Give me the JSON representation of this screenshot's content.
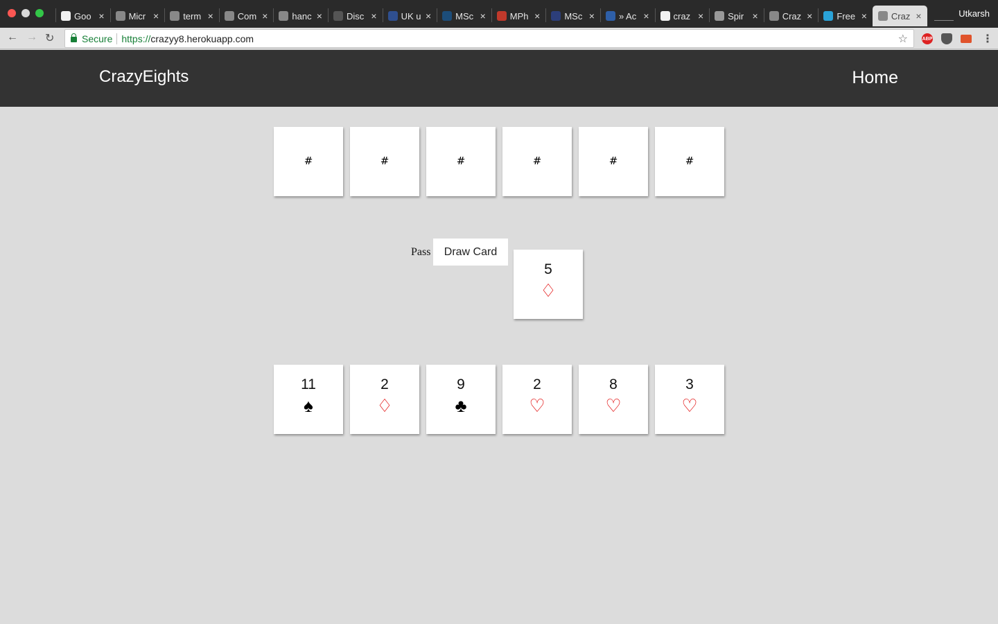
{
  "browser": {
    "tabs": [
      {
        "title": "Goo",
        "favicon": "google-drive-icon",
        "color": "#f1f1f1"
      },
      {
        "title": "Micr",
        "favicon": "page-icon",
        "color": "#888888"
      },
      {
        "title": "term",
        "favicon": "page-icon",
        "color": "#888888"
      },
      {
        "title": "Com",
        "favicon": "page-icon",
        "color": "#888888"
      },
      {
        "title": "hanc",
        "favicon": "page-icon",
        "color": "#888888"
      },
      {
        "title": "Disc",
        "favicon": "discord-icon",
        "color": "#555555"
      },
      {
        "title": "UK u",
        "favicon": "globe-icon",
        "color": "#2f4f8f"
      },
      {
        "title": "MSc",
        "favicon": "s-logo-icon",
        "color": "#1c4d7a"
      },
      {
        "title": "MPh",
        "favicon": "crest-icon",
        "color": "#c0392b"
      },
      {
        "title": "MSc",
        "favicon": "shield-icon",
        "color": "#2c3e7a"
      },
      {
        "title": "» Ac",
        "favicon": "bank-icon",
        "color": "#2e5fa8"
      },
      {
        "title": "craz",
        "favicon": "google-g-icon",
        "color": "#f1f1f1"
      },
      {
        "title": "Spir",
        "favicon": "image-icon",
        "color": "#999999"
      },
      {
        "title": "Craz",
        "favicon": "page-icon",
        "color": "#888888"
      },
      {
        "title": "Free",
        "favicon": "code-icon",
        "color": "#2aa3d8"
      },
      {
        "title": "Craz",
        "favicon": "page-icon",
        "color": "#888888",
        "active": true
      }
    ],
    "profile_name": "Utkarsh",
    "secure_label": "Secure",
    "url_scheme": "https://",
    "url_host": "crazyy8.herokuapp.com"
  },
  "navbar": {
    "brand": "CrazyEights",
    "home_label": "Home"
  },
  "opponent_hand": {
    "cards": [
      "#",
      "#",
      "#",
      "#",
      "#",
      "#"
    ]
  },
  "controls": {
    "pass_label": "Pass",
    "draw_label": "Draw Card"
  },
  "discard_pile": {
    "rank": "5",
    "suit": "♢",
    "suit_name": "diamonds",
    "suit_color": "#e00000"
  },
  "player_hand": {
    "cards": [
      {
        "rank": "11",
        "suit": "♠",
        "suit_name": "spades",
        "suit_color": "#000000"
      },
      {
        "rank": "2",
        "suit": "♢",
        "suit_name": "diamonds",
        "suit_color": "#e00000"
      },
      {
        "rank": "9",
        "suit": "♣",
        "suit_name": "clubs",
        "suit_color": "#000000"
      },
      {
        "rank": "2",
        "suit": "♡",
        "suit_name": "hearts",
        "suit_color": "#e00000"
      },
      {
        "rank": "8",
        "suit": "♡",
        "suit_name": "hearts",
        "suit_color": "#e00000"
      },
      {
        "rank": "3",
        "suit": "♡",
        "suit_name": "hearts",
        "suit_color": "#e00000"
      }
    ]
  }
}
